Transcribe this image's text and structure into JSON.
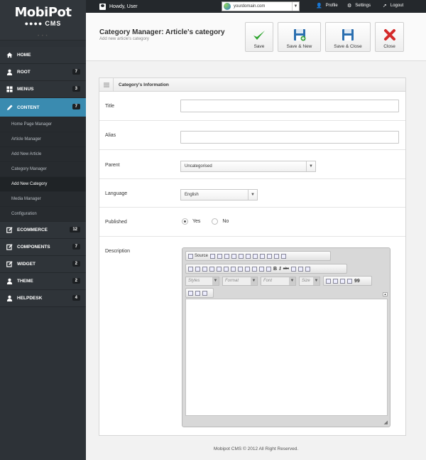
{
  "logo": {
    "name": "MobiPot",
    "sub": "CMS",
    "dots": "●●●●"
  },
  "topbar": {
    "greeting": "Howdy, User",
    "domain": "yourdomain.com",
    "links": [
      "Profile",
      "Settings",
      "Logout"
    ]
  },
  "sidebar": {
    "items": [
      {
        "label": "HOME",
        "count": ""
      },
      {
        "label": "ROOT",
        "count": "7"
      },
      {
        "label": "MENUS",
        "count": "3"
      },
      {
        "label": "CONTENT",
        "count": "7"
      }
    ],
    "subitems": [
      "Home Page Manager",
      "Article Manager",
      "Add New Article",
      "Category Manager",
      "Add New Category",
      "Media Manager",
      "Configuration"
    ],
    "items2": [
      {
        "label": "ECOMMERCE",
        "count": "12"
      },
      {
        "label": "COMPONENTS",
        "count": "7"
      },
      {
        "label": "WIDGET",
        "count": "2"
      },
      {
        "label": "THEME",
        "count": "2"
      },
      {
        "label": "HELPDESK",
        "count": "4"
      }
    ]
  },
  "header": {
    "title": "Category Manager: Article's category",
    "subtitle": "Add new article's category",
    "buttons": [
      "Save",
      "Save & New",
      "Save & Close",
      "Close"
    ]
  },
  "panel": {
    "title": "Category's Information",
    "labels": {
      "title": "Title",
      "alias": "Alias",
      "parent": "Parent",
      "language": "Language",
      "published": "Published",
      "description": "Description"
    },
    "parent_value": "Uncategorised",
    "language_value": "English",
    "published_options": [
      "Yes",
      "No"
    ],
    "published_selected": "Yes"
  },
  "editor": {
    "source_label": "Source",
    "combos": [
      "Styles",
      "Format",
      "Font",
      "Size"
    ],
    "bold": "B",
    "italic": "I",
    "strike": "abc",
    "quote": "99"
  },
  "footer": "Mobipot CMS © 2012 All Right Reserved."
}
